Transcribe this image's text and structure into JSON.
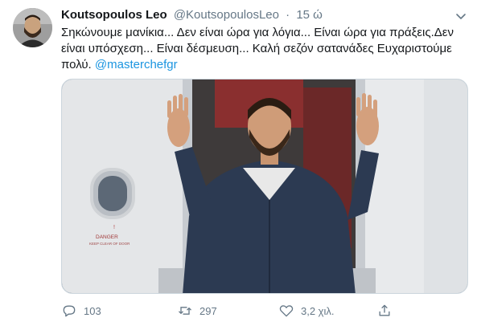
{
  "tweet": {
    "name": "Koutsopoulos Leo",
    "handle": "@KoutsopoulosLeo",
    "separator": "·",
    "time": "15 ώ",
    "text_line_1": "Σηκώνουμε μανίκια... Δεν είναι ώρα για λόγια... Είναι ώρα για πράξεις.Δεν",
    "text_line_2": "είναι υπόσχεση... Είναι δέσμευση... Καλή σεζόν σατανάδες Ευχαριστούμε",
    "text_line_3": "πολύ.",
    "mention": "@masterchefgr"
  },
  "media": {
    "sign_line_1": "DANGER",
    "sign_line_2": "KEEP CLEAR OF DOOR"
  },
  "actions": {
    "replies": "103",
    "retweets": "297",
    "likes": "3,2 χιλ."
  },
  "icons": {
    "reply": "reply-icon",
    "retweet": "retweet-icon",
    "like": "heart-icon",
    "share": "share-icon",
    "menu": "chevron-down-icon"
  },
  "colors": {
    "link": "#1b95e0",
    "muted": "#657786",
    "text": "#14171a"
  }
}
